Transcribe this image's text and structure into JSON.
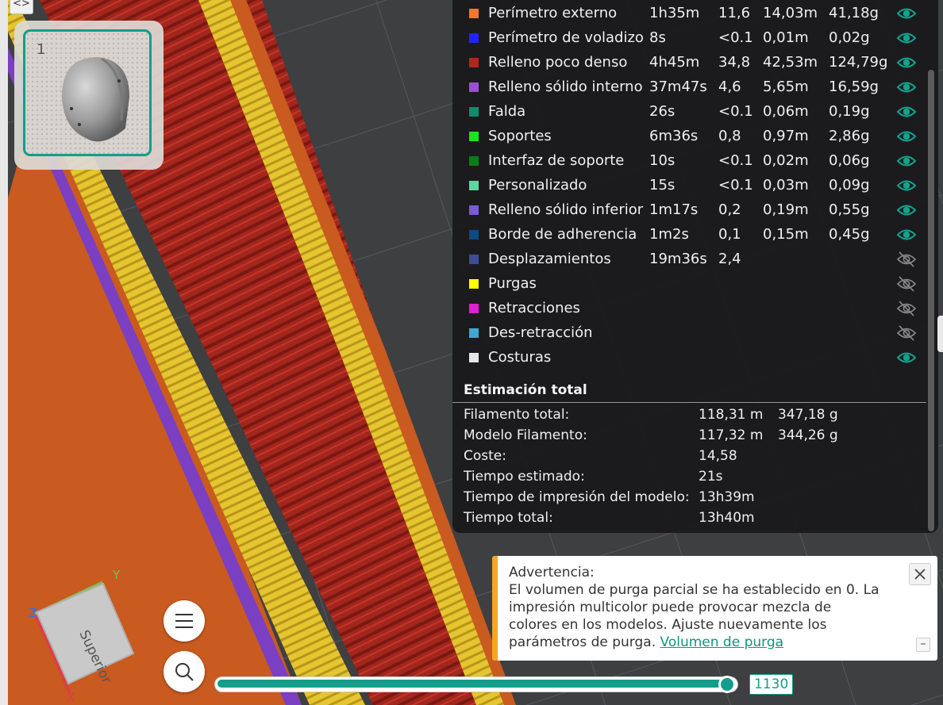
{
  "plate": {
    "number": "1"
  },
  "legend": {
    "rows": [
      {
        "name": "Perímetro externo",
        "time": "1h35m",
        "percent": "11,6",
        "length": "14,03m",
        "weight": "41,18g",
        "color": "#f07a2a",
        "visible": true
      },
      {
        "name": "Perímetro de voladizo",
        "time": "8s",
        "percent": "<0.1",
        "length": "0,01m",
        "weight": "0,02g",
        "color": "#2323ff",
        "visible": true
      },
      {
        "name": "Relleno poco denso",
        "time": "4h45m",
        "percent": "34,8",
        "length": "42,53m",
        "weight": "124,79g",
        "color": "#b0271e",
        "visible": true
      },
      {
        "name": "Relleno sólido interno",
        "time": "37m47s",
        "percent": "4,6",
        "length": "5,65m",
        "weight": "16,59g",
        "color": "#9a4fd6",
        "visible": true
      },
      {
        "name": "Falda",
        "time": "26s",
        "percent": "<0.1",
        "length": "0,06m",
        "weight": "0,19g",
        "color": "#0e8c6e",
        "visible": true
      },
      {
        "name": "Soportes",
        "time": "6m36s",
        "percent": "0,8",
        "length": "0,97m",
        "weight": "2,86g",
        "color": "#19e619",
        "visible": true
      },
      {
        "name": "Interfaz de soporte",
        "time": "10s",
        "percent": "<0.1",
        "length": "0,02m",
        "weight": "0,06g",
        "color": "#0a7e16",
        "visible": true
      },
      {
        "name": "Personalizado",
        "time": "15s",
        "percent": "<0.1",
        "length": "0,03m",
        "weight": "0,09g",
        "color": "#5ed6a0",
        "visible": true
      },
      {
        "name": "Relleno sólido inferior",
        "time": "1m17s",
        "percent": "0,2",
        "length": "0,19m",
        "weight": "0,55g",
        "color": "#7a5ad8",
        "visible": true
      },
      {
        "name": "Borde de adherencia",
        "time": "1m2s",
        "percent": "0,1",
        "length": "0,15m",
        "weight": "0,45g",
        "color": "#0c4a82",
        "visible": true
      },
      {
        "name": "Desplazamientos",
        "time": "19m36s",
        "percent": "2,4",
        "length": "",
        "weight": "",
        "color": "#3e4d9a",
        "visible": false
      },
      {
        "name": "Purgas",
        "time": "",
        "percent": "",
        "length": "",
        "weight": "",
        "color": "#ffff00",
        "visible": false
      },
      {
        "name": "Retracciones",
        "time": "",
        "percent": "",
        "length": "",
        "weight": "",
        "color": "#e01fd2",
        "visible": false
      },
      {
        "name": "Des-retracción",
        "time": "",
        "percent": "",
        "length": "",
        "weight": "",
        "color": "#3ea8d4",
        "visible": false
      },
      {
        "name": "Costuras",
        "time": "",
        "percent": "",
        "length": "",
        "weight": "",
        "color": "#e6e6e6",
        "visible": true
      }
    ],
    "eye_color_on": "#12a38c",
    "eye_color_off": "#8a8a8a"
  },
  "totals": {
    "title": "Estimación total",
    "rows": [
      {
        "label": "Filamento total:",
        "v1": "118,31 m",
        "v2": "347,18 g"
      },
      {
        "label": "Modelo Filamento:",
        "v1": "117,32 m",
        "v2": "344,26 g"
      },
      {
        "label": "Coste:",
        "v1": "14,58",
        "v2": ""
      },
      {
        "label": "Tiempo estimado:",
        "v1": "21s",
        "v2": ""
      },
      {
        "label": "Tiempo de impresión del modelo:",
        "v1": "13h39m",
        "v2": ""
      },
      {
        "label": "Tiempo total:",
        "v1": "13h40m",
        "v2": ""
      }
    ]
  },
  "warning": {
    "title": "Advertencia:",
    "message": "El volumen de purga parcial se ha establecido en 0. La impresión multicolor puede provocar mezcla de colores en los modelos. Ajuste nuevamente los parámetros de purga.",
    "link": "Volumen de purga",
    "accent": "#f5a623"
  },
  "view_cube": {
    "face_label": "Superior",
    "axis_x": "X",
    "axis_y": "Y",
    "axis_z": "Z"
  },
  "layer_slider": {
    "value": "1130",
    "fraction": 0.985
  },
  "colors": {
    "accent": "#129e8a",
    "bed": "#3a3b3d",
    "wall": "#e5c530",
    "infill": "#a3261c",
    "outer": "#c95a20",
    "internal_solid": "#7b3fc2"
  },
  "icons": {
    "toggle": "collapse-arrows-icon",
    "menu": "menu-icon",
    "search": "search-icon",
    "eye_on": "eye-icon",
    "eye_off": "eye-off-icon",
    "close": "close-icon",
    "minimize": "minimize-icon"
  }
}
